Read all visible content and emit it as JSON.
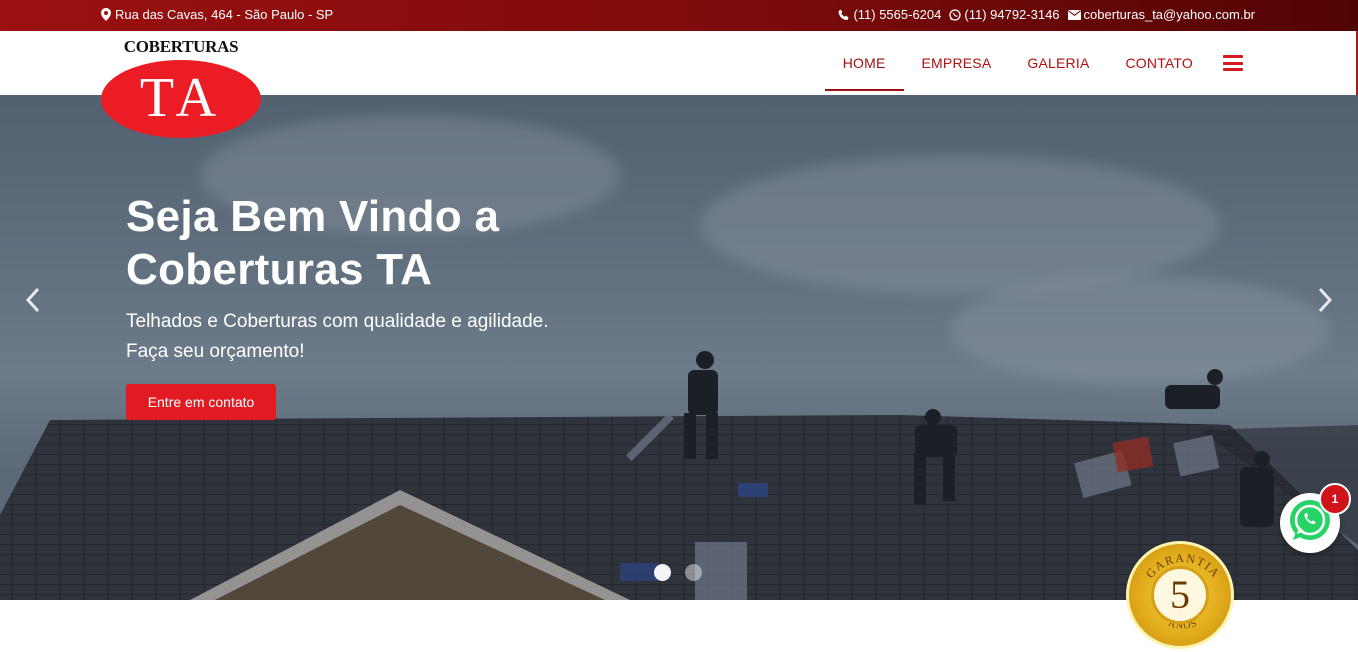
{
  "topbar": {
    "address": "Rua das Cavas, 464 - São Paulo - SP",
    "phone": "(11) 5565-6204",
    "whatsapp": "(11) 94792-3146",
    "email": "coberturas_ta@yahoo.com.br",
    "icons": [
      "map-marker-icon",
      "phone-icon",
      "whatsapp-icon",
      "envelope-icon"
    ]
  },
  "logo": {
    "top_text": "COBERTURAS",
    "main_text": "TA",
    "oval_color": "#ec1c24"
  },
  "nav": {
    "items": [
      {
        "label": "HOME",
        "active": true
      },
      {
        "label": "EMPRESA",
        "active": false
      },
      {
        "label": "GALERIA",
        "active": false
      },
      {
        "label": "CONTATO",
        "active": false
      }
    ],
    "menu_icon": "hamburger-icon",
    "accent": "#b50f0f"
  },
  "hero": {
    "title": "Seja Bem Vindo a Coberturas TA",
    "subtitle_line1": "Telhados e Coberturas com qualidade e agilidade.",
    "subtitle_line2": "Faça seu orçamento!",
    "button_label": "Entre em contato",
    "button_color": "#e21b23",
    "prev_icon": "chevron-left-icon",
    "next_icon": "chevron-right-icon",
    "slides_count": 2,
    "active_slide": 1
  },
  "whatsapp_widget": {
    "badge": "1",
    "icon": "whatsapp-icon"
  },
  "seal": {
    "top_text": "GARANTIA",
    "number": "5",
    "bottom_text": "ANOS"
  }
}
